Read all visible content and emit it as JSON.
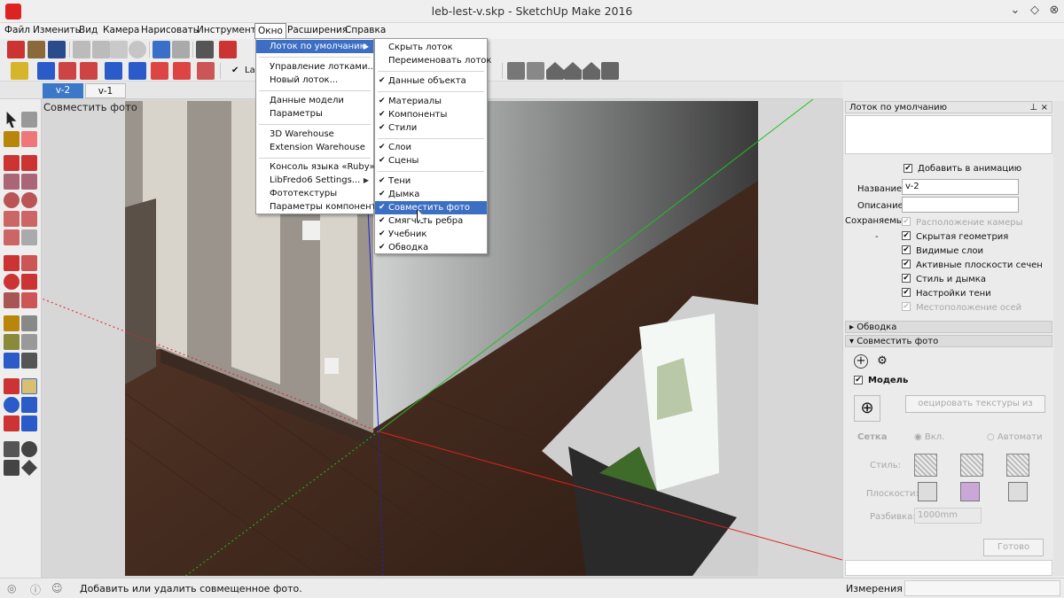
{
  "window": {
    "title": "leb-lest-v.skp - SketchUp Make 2016",
    "controls": [
      "⌄",
      "◇",
      "⊗"
    ]
  },
  "menubar": {
    "items": [
      "Файл",
      "Изменить",
      "Вид",
      "Камера",
      "Нарисовать",
      "Инструменты",
      "Окно",
      "Расширения",
      "Справка"
    ]
  },
  "toolbar2": {
    "layer_check": "✔",
    "layer_label": "La"
  },
  "tabs": [
    "v-2",
    "v-1"
  ],
  "viewport": {
    "label": "Совместить фото"
  },
  "window_menu": {
    "items": [
      "Лоток по умолчанию",
      "Управление лотками...",
      "Новый лоток...",
      "Данные модели",
      "Параметры",
      "3D Warehouse",
      "Extension Warehouse",
      "Консоль языка «Ruby»",
      "LibFredo6 Settings...",
      "Фототекстуры",
      "Параметры компонента"
    ]
  },
  "tray_menu": {
    "items": [
      "Скрыть лоток",
      "Переименовать лоток",
      "Данные объекта",
      "Материалы",
      "Компоненты",
      "Стили",
      "Слои",
      "Сцены",
      "Тени",
      "Дымка",
      "Совместить фото",
      "Смягчить ребра",
      "Учебник",
      "Обводка"
    ],
    "checked": [
      false,
      false,
      true,
      true,
      true,
      true,
      true,
      true,
      true,
      true,
      true,
      true,
      true,
      true
    ],
    "highlighted": "Совместить фото"
  },
  "panel": {
    "header": "Лоток по умолчанию",
    "add_anim": "Добавить в анимацию",
    "name_label": "Название:",
    "name_value": "v-2",
    "desc_label": "Описание:",
    "desc_value": "",
    "saved_label": "Сохраняемые",
    "saved_dash": "-",
    "props": [
      "Расположение камеры",
      "Скрытая геометрия",
      "Видимые слои",
      "Активные плоскости сечен",
      "Стиль и дымка",
      "Настройки тени",
      "Местоположение осей"
    ],
    "props_enabled": [
      false,
      true,
      true,
      true,
      true,
      true,
      false
    ],
    "section_outline": "Обводка",
    "section_match": "Совместить фото",
    "model_label": "Модель",
    "project_btn": "оецировать текстуры из фотограф",
    "grid_label": "Сетка",
    "grid_on": "Вкл.",
    "grid_auto": "Автомати",
    "style_label": "Стиль:",
    "planes_label": "Плоскости:",
    "spacing_label": "Разбивка:",
    "spacing_value": "1000mm",
    "done_btn": "Готово"
  },
  "status": {
    "message": "Добавить или удалить совмещенное фото.",
    "measure_label": "Измерения",
    "icon_info": "ⓘ",
    "icon_user": "☺",
    "icon_geo": "◎"
  },
  "colors": {
    "accent": "#3c6fc4",
    "axis_red": "#e02020",
    "axis_green": "#20c020",
    "axis_blue": "#2020e0"
  }
}
